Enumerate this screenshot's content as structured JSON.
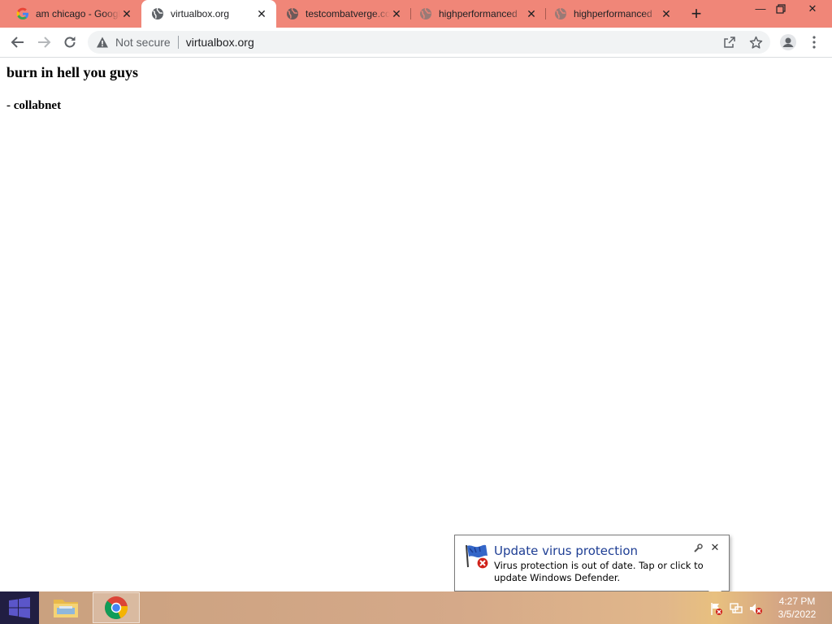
{
  "tabs": [
    {
      "title": "am chicago - Google",
      "favicon": "google-g-icon"
    },
    {
      "title": "virtualbox.org",
      "favicon": "globe-icon",
      "active": true
    },
    {
      "title": "testcombatverge.com",
      "favicon": "globe-icon"
    },
    {
      "title": "highperformanced",
      "favicon": "globe-icon"
    },
    {
      "title": "highperformanced",
      "favicon": "globe-icon"
    }
  ],
  "toolbar": {
    "security_label": "Not secure",
    "url": "virtualbox.org"
  },
  "page": {
    "heading": "burn in hell you guys",
    "byline": "- collabnet"
  },
  "notification": {
    "title": "Update virus protection",
    "body": "Virus protection is out of date. Tap or click to update Windows Defender."
  },
  "taskbar": {
    "time": "4:27 PM",
    "date": "3/5/2022"
  },
  "colors": {
    "tabstrip": "#f08678",
    "notif_title": "#1e3e94",
    "start_bg": "#211e42"
  }
}
